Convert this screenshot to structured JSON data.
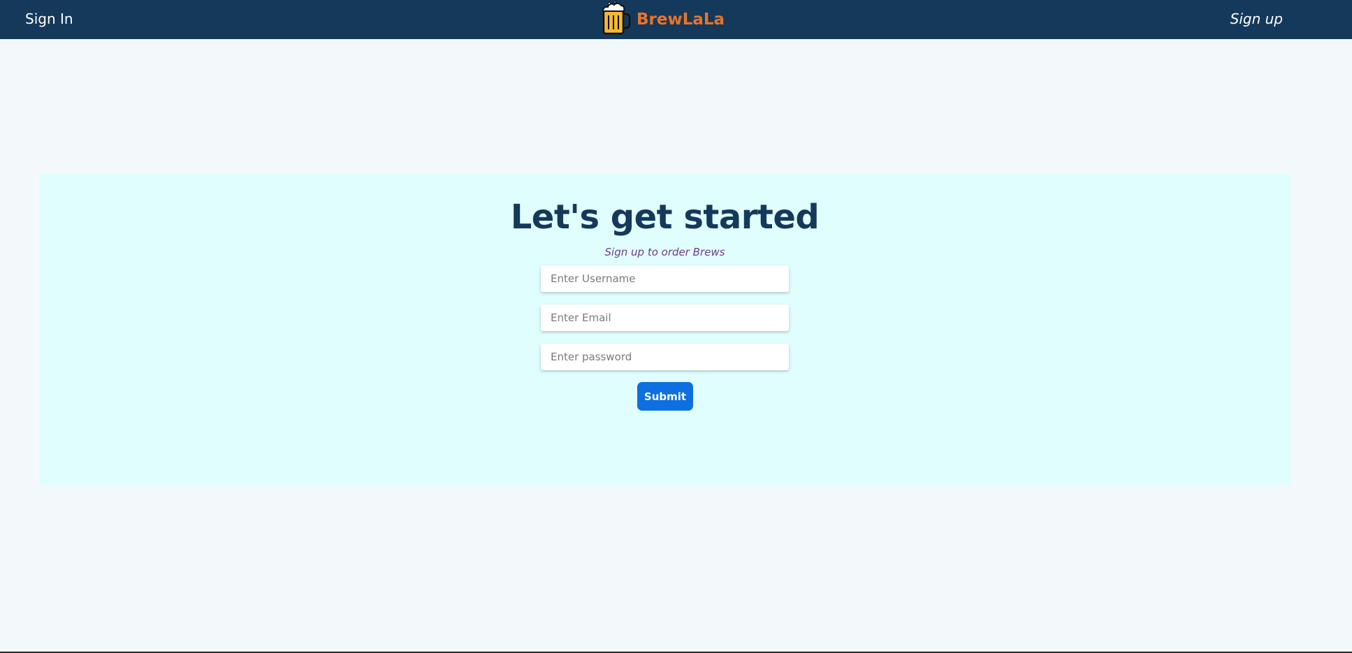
{
  "navbar": {
    "signin_label": "Sign In",
    "brand_name": "BrewLaLa",
    "brand_icon": "beer-mug-icon",
    "signup_label": "Sign up"
  },
  "form": {
    "title": "Let's get started",
    "subtitle": "Sign up to order Brews",
    "username_placeholder": "Enter Username",
    "username_value": "",
    "email_placeholder": "Enter Email",
    "email_value": "",
    "password_placeholder": "Enter password",
    "password_value": "",
    "submit_label": "Submit"
  },
  "colors": {
    "navbar_bg": "#15395b",
    "brand": "#e8742a",
    "page_bg": "#f3f8fb",
    "panel_bg": "#e1fefe",
    "heading": "#15395b",
    "subtitle": "#6d3c86",
    "button": "#0d6fe0"
  }
}
